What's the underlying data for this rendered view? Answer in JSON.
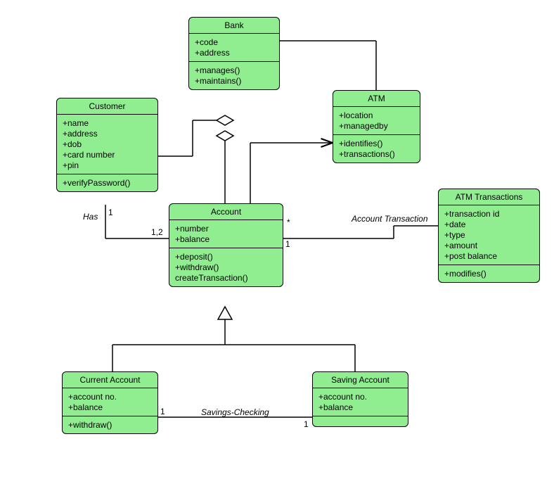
{
  "classes": {
    "bank": {
      "name": "Bank",
      "attrs": [
        "+code",
        "+address"
      ],
      "ops": [
        "+manages()",
        "+maintains()"
      ]
    },
    "customer": {
      "name": "Customer",
      "attrs": [
        "+name",
        "+address",
        "+dob",
        "+card number",
        "+pin"
      ],
      "ops": [
        "+verifyPassword()"
      ]
    },
    "atm": {
      "name": "ATM",
      "attrs": [
        "+location",
        "+managedby"
      ],
      "ops": [
        "+identifies()",
        "+transactions()"
      ]
    },
    "account": {
      "name": "Account",
      "attrs": [
        "+number",
        "+balance"
      ],
      "ops": [
        "+deposit()",
        "+withdraw()",
        "createTransaction()"
      ]
    },
    "atmtrans": {
      "name": "ATM Transactions",
      "attrs": [
        "+transaction id",
        "+date",
        "+type",
        "+amount",
        "+post balance"
      ],
      "ops": [
        "+modifies()"
      ]
    },
    "current": {
      "name": "Current Account",
      "attrs": [
        "+account no.",
        "+balance"
      ],
      "ops": [
        "+withdraw()"
      ]
    },
    "saving": {
      "name": "Saving Account",
      "attrs": [
        "+account no.",
        "+balance"
      ],
      "ops": []
    }
  },
  "relLabels": {
    "has": "Has",
    "savingsChecking": "Savings-Checking",
    "accountTransaction": "Account Transaction"
  },
  "multiplicities": {
    "customerHas1": "1",
    "accountHas12": "1,2",
    "accountStar": "*",
    "accountTrans1": "1",
    "current1": "1",
    "saving1": "1"
  }
}
